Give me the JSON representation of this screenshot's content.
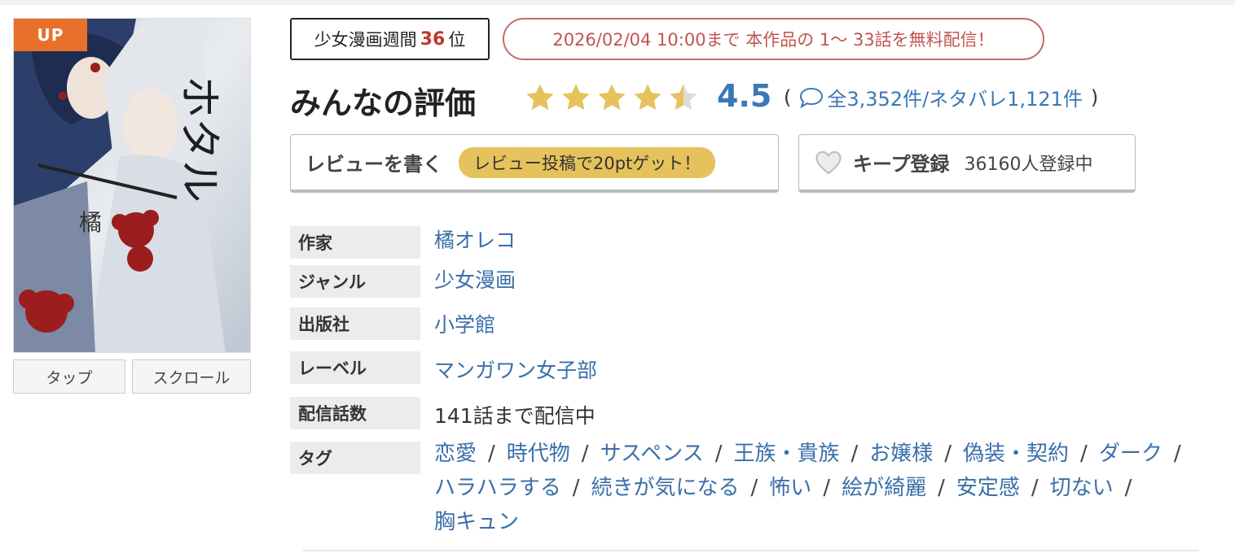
{
  "cover": {
    "badge": "UP",
    "buttons": [
      "タップ",
      "スクロール"
    ]
  },
  "ranking": {
    "prefix": "少女漫画週間",
    "rank": "36",
    "suffix": "位"
  },
  "free_notice": "2026/02/04 10:00まで 本作品の 1〜 33話を無料配信！",
  "rating": {
    "title": "みんなの評価",
    "score": "4.5",
    "stars_value": 4.5,
    "stars_max": 5,
    "open": "(",
    "count_text": "全3,352件/ネタバレ1,121件",
    "close": ")"
  },
  "review_button": {
    "label": "レビューを書く",
    "pill": "レビュー投稿で20ptゲット！"
  },
  "keep_button": {
    "label": "キープ登録",
    "count": "36160人登録中"
  },
  "info": {
    "author_label": "作家",
    "author": "橘オレコ",
    "genre_label": "ジャンル",
    "genre": "少女漫画",
    "publisher_label": "出版社",
    "publisher": "小学館",
    "imprint_label": "レーベル",
    "imprint": "マンガワン女子部",
    "episodes_label": "配信話数",
    "episodes": "141話まで配信中",
    "tags_label": "タグ",
    "tags": [
      "恋愛",
      "時代物",
      "サスペンス",
      "王族・貴族",
      "お嬢様",
      "偽装・契約",
      "ダーク",
      "ハラハラする",
      "続きが気になる",
      "怖い",
      "絵が綺麗",
      "安定感",
      "切ない",
      "胸キュン"
    ],
    "tag_separator": "/"
  },
  "colors": {
    "link_blue": "#3a6fa8",
    "score_blue": "#3a78b5",
    "star_gold": "#e6c25c",
    "rank_red": "#c0392b",
    "badge_orange": "#e8702a"
  }
}
